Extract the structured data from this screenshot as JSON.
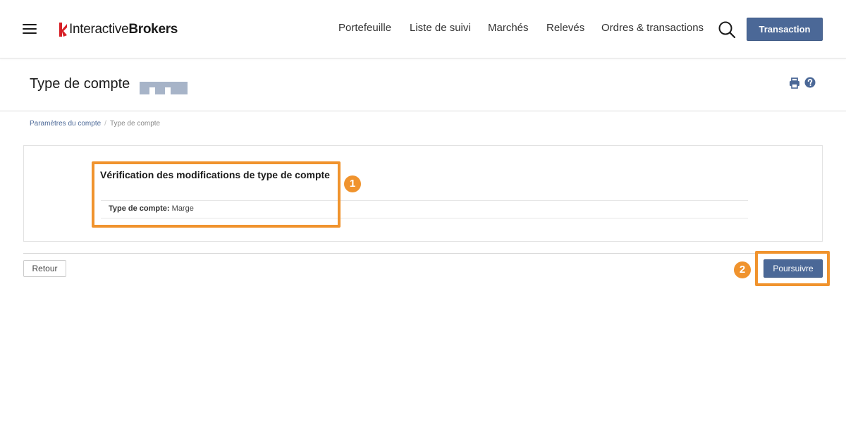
{
  "logo": {
    "part1": "Interactive",
    "part2": "Brokers"
  },
  "nav": [
    {
      "label": "Portefeuille"
    },
    {
      "label": "Liste de suivi"
    },
    {
      "label": "Marchés"
    },
    {
      "label": "Relevés"
    },
    {
      "label": "Ordres & transactions"
    }
  ],
  "header": {
    "transaction_label": "Transaction"
  },
  "page": {
    "title": "Type de compte"
  },
  "breadcrumb": {
    "parent": "Paramètres du compte",
    "separator": "/",
    "current": "Type de compte"
  },
  "verification": {
    "title": "Vérification des modifications de type de compte",
    "field_label": "Type de compte:",
    "field_value": "Marge"
  },
  "annotations": {
    "badge1": "1",
    "badge2": "2"
  },
  "actions": {
    "back_label": "Retour",
    "continue_label": "Poursuivre"
  },
  "colors": {
    "primary": "#4b6897",
    "highlight": "#f0932d",
    "logo_red": "#d71f26"
  },
  "icons": {
    "menu": "hamburger-icon",
    "search": "search-icon",
    "print": "print-icon",
    "help": "help-icon"
  }
}
